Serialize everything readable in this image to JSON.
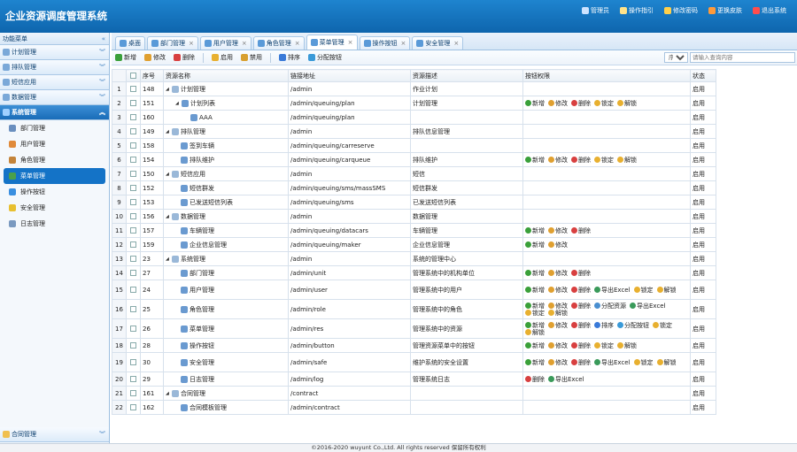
{
  "app": {
    "title": "企业资源调度管理系统"
  },
  "header": {
    "links": [
      {
        "label": "管理员",
        "icon": "user-icon",
        "color": "#cde3ff"
      },
      {
        "label": "操作指引",
        "icon": "guide-icon",
        "color": "#ffe38a"
      },
      {
        "label": "修改密码",
        "icon": "key-icon",
        "color": "#ffd04a"
      },
      {
        "label": "更换皮肤",
        "icon": "skin-icon",
        "color": "#ff9a3a"
      },
      {
        "label": "退出系统",
        "icon": "power-icon",
        "color": "#ff4d4d"
      }
    ]
  },
  "sidebar": {
    "caption": "功能菜单",
    "groups": [
      {
        "label": "计划管理",
        "icon": "plan-icon"
      },
      {
        "label": "排队管理",
        "icon": "queue-icon"
      },
      {
        "label": "短信应用",
        "icon": "sms-icon"
      },
      {
        "label": "数据管理",
        "icon": "data-icon"
      }
    ],
    "active": {
      "label": "系统管理",
      "icon": "tools-icon"
    },
    "items": [
      {
        "label": "部门管理",
        "icon": "department-icon",
        "color": "#6a8fbf"
      },
      {
        "label": "用户管理",
        "icon": "user-icon",
        "color": "#e08a3a"
      },
      {
        "label": "角色管理",
        "icon": "role-icon",
        "color": "#c4843a"
      },
      {
        "label": "菜单管理",
        "icon": "menu-tree-icon",
        "color": "#4aa04a"
      },
      {
        "label": "操作按钮",
        "icon": "button-icon",
        "color": "#3a8fe0"
      },
      {
        "label": "安全管理",
        "icon": "shield-icon",
        "color": "#e8c030"
      },
      {
        "label": "日志管理",
        "icon": "log-icon",
        "color": "#7a9ac0"
      }
    ],
    "selected_index": 3,
    "bottom_group": {
      "label": "合同管理",
      "icon": "folder-icon"
    }
  },
  "tabs": [
    {
      "label": "桌面",
      "icon": "home-icon",
      "closable": false
    },
    {
      "label": "部门管理",
      "icon": "department-icon",
      "closable": true
    },
    {
      "label": "用户管理",
      "icon": "user-icon",
      "closable": true
    },
    {
      "label": "角色管理",
      "icon": "role-icon",
      "closable": true
    },
    {
      "label": "菜单管理",
      "icon": "menu-tree-icon",
      "closable": true,
      "active": true
    },
    {
      "label": "操作按钮",
      "icon": "button-icon",
      "closable": true
    },
    {
      "label": "安全管理",
      "icon": "shield-icon",
      "closable": true
    }
  ],
  "toolbar": {
    "buttons": [
      {
        "label": "新增",
        "icon": "add-icon",
        "color": "#3aa03a"
      },
      {
        "label": "修改",
        "icon": "edit-icon",
        "color": "#e0a030"
      },
      {
        "label": "删除",
        "icon": "delete-icon",
        "color": "#d84040"
      },
      {
        "label": "启用",
        "icon": "enable-icon",
        "color": "#e8b030"
      },
      {
        "label": "禁用",
        "icon": "disable-icon",
        "color": "#d8a030"
      },
      {
        "label": "排序",
        "icon": "sort-icon",
        "color": "#3a7ad8"
      },
      {
        "label": "分配按钮",
        "icon": "assign-icon",
        "color": "#3a9ad8"
      }
    ],
    "search_select": "序号",
    "search_placeholder": "请输入查询内容"
  },
  "table": {
    "columns": [
      "序号",
      "资源名称",
      "链接地址",
      "资源描述",
      "按钮权限",
      "状态"
    ],
    "rows": [
      {
        "no": "1",
        "id": "148",
        "level": 0,
        "expand": true,
        "name": "计划管理",
        "icon": "folder-icon",
        "url": "/admin",
        "desc": "作业计划",
        "perms": [],
        "status": "启用"
      },
      {
        "no": "2",
        "id": "151",
        "level": 1,
        "expand": true,
        "name": "计划列表",
        "icon": "list-icon",
        "url": "/admin/queuing/plan",
        "desc": "计划管理",
        "perms": [
          "新增",
          "修改",
          "删除",
          "锁定",
          "解锁"
        ],
        "status": "启用"
      },
      {
        "no": "3",
        "id": "160",
        "level": 2,
        "expand": false,
        "name": "AAA",
        "icon": "android-icon",
        "url": "/admin/queuing/plan",
        "desc": "",
        "perms": [],
        "status": "启用"
      },
      {
        "no": "4",
        "id": "149",
        "level": 0,
        "expand": true,
        "name": "排队管理",
        "icon": "queue-icon",
        "url": "/admin",
        "desc": "排队信息管理",
        "perms": [],
        "status": "启用"
      },
      {
        "no": "5",
        "id": "158",
        "level": 1,
        "expand": false,
        "name": "签到车辆",
        "icon": "car-icon",
        "url": "/admin/queuing/carreserve",
        "desc": "",
        "perms": [],
        "status": "启用"
      },
      {
        "no": "6",
        "id": "154",
        "level": 1,
        "expand": false,
        "name": "排队维护",
        "icon": "maintain-icon",
        "url": "/admin/queuing/carqueue",
        "desc": "排队维护",
        "perms": [
          "新增",
          "修改",
          "删除",
          "锁定",
          "解锁"
        ],
        "status": "启用"
      },
      {
        "no": "7",
        "id": "150",
        "level": 0,
        "expand": true,
        "name": "短信应用",
        "icon": "sms-icon",
        "url": "/admin",
        "desc": "短信",
        "perms": [],
        "status": "启用"
      },
      {
        "no": "8",
        "id": "152",
        "level": 1,
        "expand": false,
        "name": "短信群发",
        "icon": "mass-sms-icon",
        "url": "/admin/queuing/sms/massSMS",
        "desc": "短信群发",
        "perms": [],
        "status": "启用"
      },
      {
        "no": "9",
        "id": "153",
        "level": 1,
        "expand": false,
        "name": "已发送短信列表",
        "icon": "sent-list-icon",
        "url": "/admin/queuing/sms",
        "desc": "已发送短信列表",
        "perms": [],
        "status": "启用"
      },
      {
        "no": "10",
        "id": "156",
        "level": 0,
        "expand": true,
        "name": "数据管理",
        "icon": "data-icon",
        "url": "/admin",
        "desc": "数据管理",
        "perms": [],
        "status": "启用"
      },
      {
        "no": "11",
        "id": "157",
        "level": 1,
        "expand": false,
        "name": "车辆管理",
        "icon": "car-icon",
        "url": "/admin/queuing/datacars",
        "desc": "车辆管理",
        "perms": [
          "新增",
          "修改",
          "删除"
        ],
        "status": "启用"
      },
      {
        "no": "12",
        "id": "159",
        "level": 1,
        "expand": false,
        "name": "企业信息管理",
        "icon": "enterprise-icon",
        "url": "/admin/queuing/maker",
        "desc": "企业信息管理",
        "perms": [
          "新增",
          "修改"
        ],
        "status": "启用"
      },
      {
        "no": "13",
        "id": "23",
        "level": 0,
        "expand": true,
        "name": "系统管理",
        "icon": "tools-icon",
        "url": "/admin",
        "desc": "系统的管理中心",
        "perms": [],
        "status": "启用"
      },
      {
        "no": "14",
        "id": "27",
        "level": 1,
        "expand": false,
        "name": "部门管理",
        "icon": "department-icon",
        "url": "/admin/unit",
        "desc": "管理系统中的机构单位",
        "perms": [
          "新增",
          "修改",
          "删除"
        ],
        "status": "启用"
      },
      {
        "no": "15",
        "id": "24",
        "level": 1,
        "expand": false,
        "name": "用户管理",
        "icon": "user-icon",
        "url": "/admin/user",
        "desc": "管理系统中的用户",
        "perms": [
          "新增",
          "修改",
          "删除",
          "导出Excel",
          "锁定",
          "解锁"
        ],
        "status": "启用"
      },
      {
        "no": "16",
        "id": "25",
        "level": 1,
        "expand": false,
        "name": "角色管理",
        "icon": "role-icon",
        "url": "/admin/role",
        "desc": "管理系统中的角色",
        "perms": [
          "新增",
          "修改",
          "删除",
          "分配资源",
          "导出Excel",
          "锁定",
          "解锁"
        ],
        "status": "启用"
      },
      {
        "no": "17",
        "id": "26",
        "level": 1,
        "expand": false,
        "name": "菜单管理",
        "icon": "menu-tree-icon",
        "url": "/admin/res",
        "desc": "管理系统中的资源",
        "perms": [
          "新增",
          "修改",
          "删除",
          "排序",
          "分配按钮",
          "锁定",
          "解锁"
        ],
        "status": "启用"
      },
      {
        "no": "18",
        "id": "28",
        "level": 1,
        "expand": false,
        "name": "操作按钮",
        "icon": "button-icon",
        "url": "/admin/button",
        "desc": "管理资源菜单中的按钮",
        "perms": [
          "新增",
          "修改",
          "删除",
          "锁定",
          "解锁"
        ],
        "status": "启用"
      },
      {
        "no": "19",
        "id": "30",
        "level": 1,
        "expand": false,
        "name": "安全管理",
        "icon": "shield-icon",
        "url": "/admin/safe",
        "desc": "维护系统的安全设置",
        "perms": [
          "新增",
          "修改",
          "删除",
          "导出Excel",
          "锁定",
          "解锁"
        ],
        "status": "启用"
      },
      {
        "no": "20",
        "id": "29",
        "level": 1,
        "expand": false,
        "name": "日志管理",
        "icon": "log-icon",
        "url": "/admin/log",
        "desc": "管理系统日志",
        "perms": [
          "删除",
          "导出Excel"
        ],
        "status": "启用"
      },
      {
        "no": "21",
        "id": "161",
        "level": 0,
        "expand": true,
        "name": "合同管理",
        "icon": "folder-icon",
        "url": "/contract",
        "desc": "",
        "perms": [],
        "status": "启用"
      },
      {
        "no": "22",
        "id": "162",
        "level": 1,
        "expand": false,
        "name": "合同模板管理",
        "icon": "template-icon",
        "url": "/admin/contract",
        "desc": "",
        "perms": [],
        "status": "启用"
      }
    ]
  },
  "perm_colors": {
    "新增": "#3aa03a",
    "修改": "#e0a030",
    "删除": "#d84040",
    "锁定": "#e8b030",
    "解锁": "#e8b030",
    "导出Excel": "#3a9a5a",
    "分配资源": "#4a8fd0",
    "排序": "#3a7ad8",
    "分配按钮": "#3a9ad8"
  },
  "perm_icons": {
    "新增": "add-icon",
    "修改": "edit-icon",
    "删除": "delete-icon",
    "锁定": "lock-icon",
    "解锁": "unlock-icon",
    "导出Excel": "excel-icon",
    "分配资源": "assign-resource-icon",
    "排序": "sort-icon",
    "分配按钮": "assign-icon"
  },
  "footer": {
    "text": "©2016-2020 wuyunt Co.,Ltd. All rights reserved 保留所有权利"
  }
}
